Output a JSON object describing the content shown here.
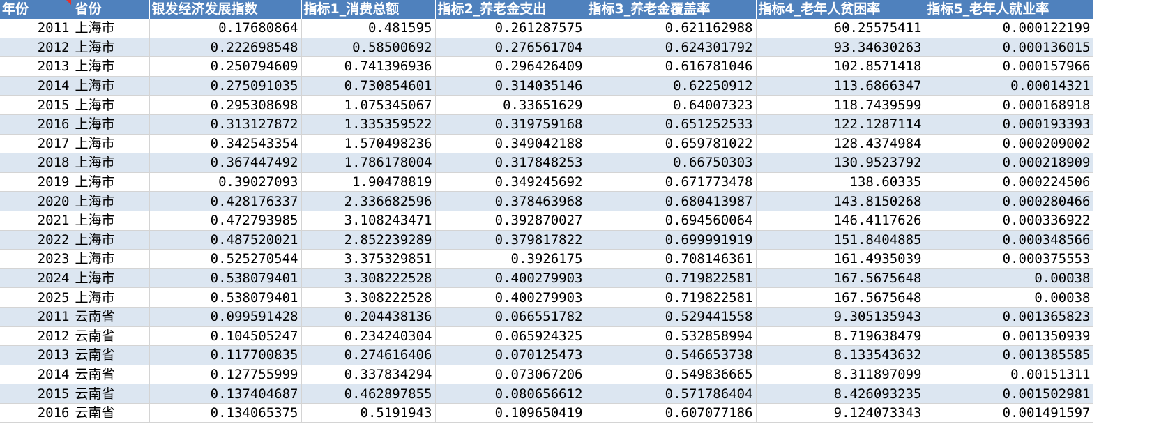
{
  "headers": [
    "年份",
    "省份",
    "银发经济发展指数",
    "指标1_消费总额",
    "指标2_养老金支出",
    "指标3_养老金覆盖率",
    "指标4_老年人贫困率",
    "指标5_老年人就业率"
  ],
  "rows": [
    [
      "2011",
      "上海市",
      "0.17680864",
      "0.481595",
      "0.261287575",
      "0.621162988",
      "60.25575411",
      "0.000122199"
    ],
    [
      "2012",
      "上海市",
      "0.222698548",
      "0.58500692",
      "0.276561704",
      "0.624301792",
      "93.34630263",
      "0.000136015"
    ],
    [
      "2013",
      "上海市",
      "0.250794609",
      "0.741396936",
      "0.296426409",
      "0.616781046",
      "102.8571418",
      "0.000157966"
    ],
    [
      "2014",
      "上海市",
      "0.275091035",
      "0.730854601",
      "0.314035146",
      "0.62250912",
      "113.6866347",
      "0.00014321"
    ],
    [
      "2015",
      "上海市",
      "0.295308698",
      "1.075345067",
      "0.33651629",
      "0.64007323",
      "118.7439599",
      "0.000168918"
    ],
    [
      "2016",
      "上海市",
      "0.313127872",
      "1.335359522",
      "0.319759168",
      "0.651252533",
      "122.1287114",
      "0.000193393"
    ],
    [
      "2017",
      "上海市",
      "0.342543354",
      "1.570498236",
      "0.349042188",
      "0.659781022",
      "128.4374984",
      "0.000209002"
    ],
    [
      "2018",
      "上海市",
      "0.367447492",
      "1.786178004",
      "0.317848253",
      "0.66750303",
      "130.9523792",
      "0.000218909"
    ],
    [
      "2019",
      "上海市",
      "0.39027093",
      "1.90478819",
      "0.349245692",
      "0.671773478",
      "138.60335",
      "0.000224506"
    ],
    [
      "2020",
      "上海市",
      "0.428176337",
      "2.336682596",
      "0.378463968",
      "0.680413987",
      "143.8150268",
      "0.000280466"
    ],
    [
      "2021",
      "上海市",
      "0.472793985",
      "3.108243471",
      "0.392870027",
      "0.694560064",
      "146.4117626",
      "0.000336922"
    ],
    [
      "2022",
      "上海市",
      "0.487520021",
      "2.852239289",
      "0.379817822",
      "0.699991919",
      "151.8404885",
      "0.000348566"
    ],
    [
      "2023",
      "上海市",
      "0.525270544",
      "3.375329851",
      "0.3926175",
      "0.708146361",
      "161.4935039",
      "0.000375553"
    ],
    [
      "2024",
      "上海市",
      "0.538079401",
      "3.308222528",
      "0.400279903",
      "0.719822581",
      "167.5675648",
      "0.00038"
    ],
    [
      "2025",
      "上海市",
      "0.538079401",
      "3.308222528",
      "0.400279903",
      "0.719822581",
      "167.5675648",
      "0.00038"
    ],
    [
      "2011",
      "云南省",
      "0.099591428",
      "0.204438136",
      "0.066551782",
      "0.529441558",
      "9.305135943",
      "0.001365823"
    ],
    [
      "2012",
      "云南省",
      "0.104505247",
      "0.234240304",
      "0.065924325",
      "0.532858994",
      "8.719638479",
      "0.001350939"
    ],
    [
      "2013",
      "云南省",
      "0.117700835",
      "0.274616406",
      "0.070125473",
      "0.546653738",
      "8.133543632",
      "0.001385585"
    ],
    [
      "2014",
      "云南省",
      "0.127755999",
      "0.337834294",
      "0.073067206",
      "0.549836665",
      "8.311897099",
      "0.00151311"
    ],
    [
      "2015",
      "云南省",
      "0.137404687",
      "0.462897855",
      "0.080656612",
      "0.571786404",
      "8.426093235",
      "0.001502981"
    ],
    [
      "2016",
      "云南省",
      "0.134065375",
      "0.5191943",
      "0.109650419",
      "0.607077186",
      "9.124073343",
      "0.001491597"
    ]
  ]
}
